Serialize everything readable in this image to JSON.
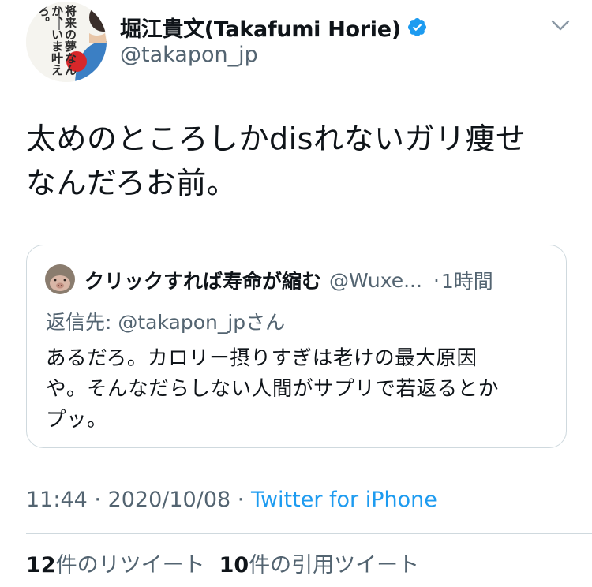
{
  "author": {
    "display_name": "堀江貴文(Takafumi Horie)",
    "handle": "@takapon_jp",
    "avatar_text": "将来の夢なんか、いま叶えろ。",
    "verified_icon": "verified-badge-icon"
  },
  "tweet": {
    "text_line1": "太めのところしかdisれないガリ痩せ",
    "text_line2": "なんだろお前。"
  },
  "quoted_tweet": {
    "name": "クリックすれば寿命が縮む",
    "handle": "@Wuxe...",
    "separator": "·",
    "time": "1時間",
    "reply_to": "返信先: @takapon_jpさん",
    "body_line1": "あるだろ。カロリー摂りすぎは老けの最大原因",
    "body_line2": "や。そんなだらしない人間がサプリで若返るとか",
    "body_line3": "プッ。"
  },
  "meta": {
    "time": "11:44",
    "separator1": " · ",
    "date": "2020/10/08",
    "separator2": " · ",
    "source": "Twitter for iPhone"
  },
  "stats": {
    "retweets_count": "12",
    "retweets_label": "件のリツイート",
    "quotes_count": "10",
    "quotes_label": "件の引用ツイート"
  },
  "colors": {
    "accent": "#1d9bf0",
    "text": "#0f1419",
    "secondary": "#536471",
    "border": "#cfd9de"
  }
}
